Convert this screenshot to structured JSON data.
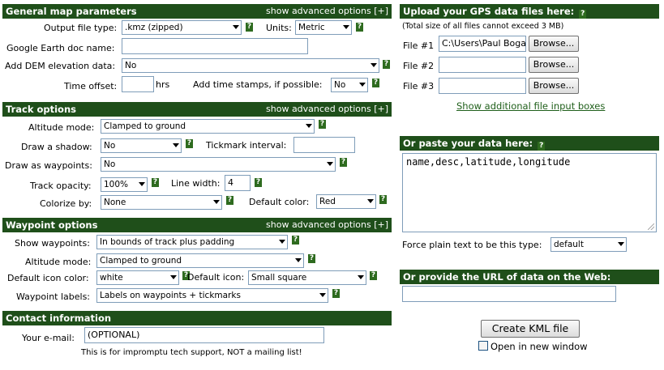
{
  "general": {
    "title": "General map parameters",
    "advanced": "show advanced options [+]",
    "output_file_type_label": "Output file type:",
    "output_file_type_value": ".kmz (zipped)",
    "units_label": "Units:",
    "units_value": "Metric",
    "ge_doc_name_label": "Google Earth doc name:",
    "dem_label": "Add DEM elevation data:",
    "dem_value": "No",
    "time_offset_label": "Time offset:",
    "hrs": "hrs",
    "timestamps_label": "Add time stamps, if possible:",
    "timestamps_value": "No"
  },
  "track": {
    "title": "Track options",
    "advanced": "show advanced options [+]",
    "altitude_label": "Altitude mode:",
    "altitude_value": "Clamped to ground",
    "shadow_label": "Draw a shadow:",
    "shadow_value": "No",
    "tickmark_label": "Tickmark interval:",
    "waypoints_label": "Draw as waypoints:",
    "waypoints_value": "No",
    "opacity_label": "Track opacity:",
    "opacity_value": "100%",
    "linewidth_label": "Line width:",
    "linewidth_value": "4",
    "colorize_label": "Colorize by:",
    "colorize_value": "None",
    "defcolor_label": "Default color:",
    "defcolor_value": "Red"
  },
  "waypoint": {
    "title": "Waypoint options",
    "advanced": "show advanced options [+]",
    "show_label": "Show waypoints:",
    "show_value": "In bounds of track plus padding",
    "altitude_label": "Altitude mode:",
    "altitude_value": "Clamped to ground",
    "iconcolor_label": "Default icon color:",
    "iconcolor_value": "white",
    "icon_label": "Default icon:",
    "icon_value": "Small square",
    "labels_label": "Waypoint labels:",
    "labels_value": "Labels on waypoints + tickmarks"
  },
  "contact": {
    "title": "Contact information",
    "email_label": "Your e-mail:",
    "email_value": "(OPTIONAL)",
    "note": "This is for impromptu tech support, NOT a mailing list!"
  },
  "upload": {
    "title": "Upload your GPS data files here:",
    "subtitle": "(Total size of all files cannot exceed 3 MB)",
    "files": [
      {
        "label": "File #1",
        "value": "C:\\Users\\Paul Bogard",
        "button": "Browse..."
      },
      {
        "label": "File #2",
        "value": "",
        "button": "Browse..."
      },
      {
        "label": "File #3",
        "value": "",
        "button": "Browse..."
      }
    ],
    "more_link": "Show additional file input boxes"
  },
  "paste": {
    "title": "Or paste your data here:",
    "text": "name,desc,latitude,longitude",
    "force_label": "Force plain text to be this type:",
    "force_value": "default"
  },
  "url": {
    "title": "Or provide the URL of data on the Web:",
    "value": ""
  },
  "actions": {
    "create": "Create KML file",
    "new_window": "Open in new window"
  },
  "help_glyph": "?",
  "colors": {
    "header_bg": "#1f4f1a",
    "link": "#1f5f1a"
  }
}
